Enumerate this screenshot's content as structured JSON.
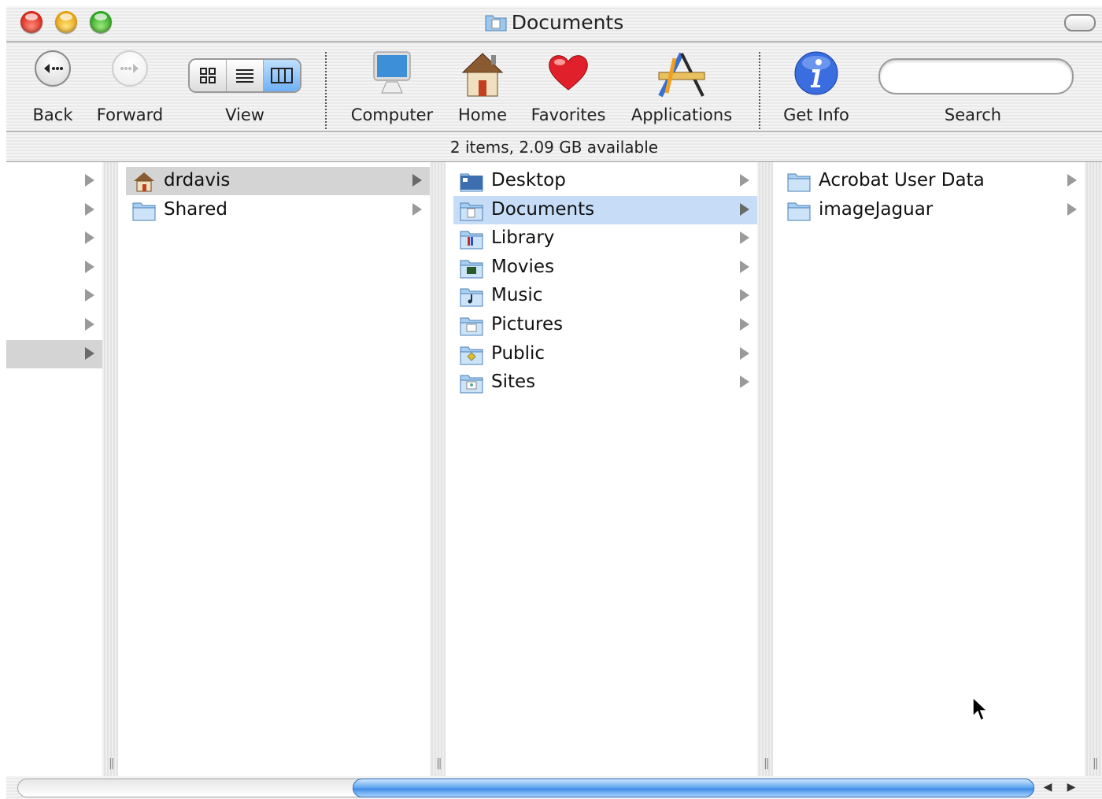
{
  "window": {
    "title": "Documents",
    "title_icon": "documents-folder-icon"
  },
  "toolbar": {
    "back_label": "Back",
    "forward_label": "Forward",
    "view_label": "View",
    "view_modes": [
      "icon-view-icon",
      "list-view-icon",
      "column-view-icon"
    ],
    "view_selected": "column-view-icon",
    "computer_label": "Computer",
    "home_label": "Home",
    "favorites_label": "Favorites",
    "applications_label": "Applications",
    "getinfo_label": "Get Info",
    "search_label": "Search",
    "search_value": ""
  },
  "status": {
    "text": "2 items, 2.09 GB available"
  },
  "columns": [
    {
      "items": [
        {
          "name": "",
          "icon": ""
        },
        {
          "name": "",
          "icon": ""
        },
        {
          "name": "",
          "icon": ""
        },
        {
          "name": "",
          "icon": ""
        },
        {
          "name": "",
          "icon": ""
        },
        {
          "name": "",
          "icon": ""
        },
        {
          "name": "",
          "icon": "",
          "selected": "gray"
        }
      ]
    },
    {
      "items": [
        {
          "name": "drdavis",
          "icon": "home-icon",
          "selected": "gray"
        },
        {
          "name": "Shared",
          "icon": "folder-icon"
        }
      ]
    },
    {
      "items": [
        {
          "name": "Desktop",
          "icon": "desktop-folder-icon"
        },
        {
          "name": "Documents",
          "icon": "documents-folder-icon",
          "selected": "blue"
        },
        {
          "name": "Library",
          "icon": "library-folder-icon"
        },
        {
          "name": "Movies",
          "icon": "movies-folder-icon"
        },
        {
          "name": "Music",
          "icon": "music-folder-icon"
        },
        {
          "name": "Pictures",
          "icon": "pictures-folder-icon"
        },
        {
          "name": "Public",
          "icon": "public-folder-icon"
        },
        {
          "name": "Sites",
          "icon": "sites-folder-icon"
        }
      ]
    },
    {
      "items": [
        {
          "name": "Acrobat User Data",
          "icon": "folder-icon"
        },
        {
          "name": "imageJaguar",
          "icon": "folder-icon"
        }
      ]
    }
  ],
  "colors": {
    "selection_blue": "#c6dcf7",
    "selection_gray": "#d4d4d4",
    "scroll_blue": "#3d8ce6"
  }
}
